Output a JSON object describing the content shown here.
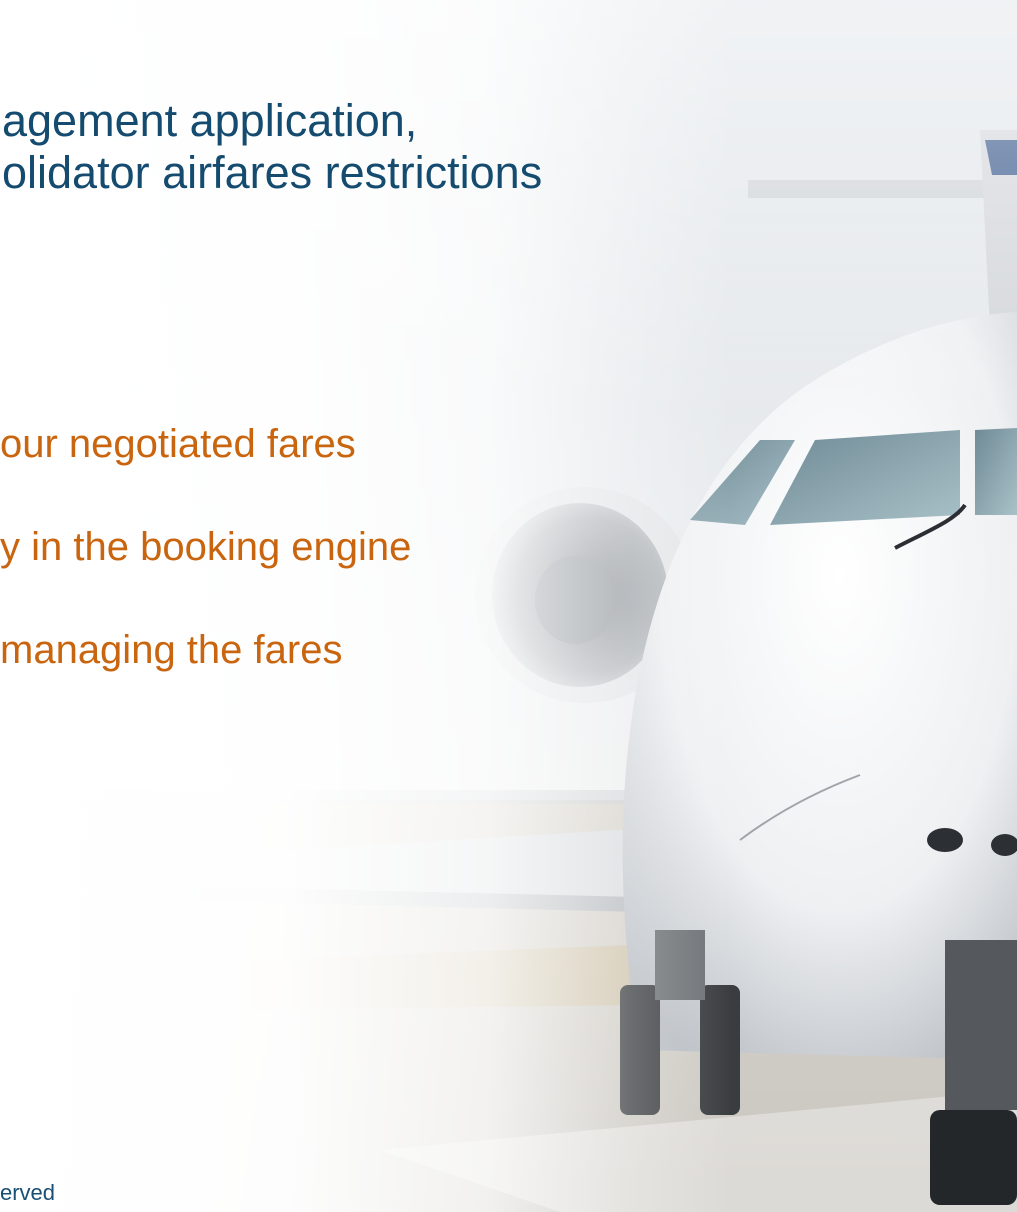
{
  "slide": {
    "title_lines": [
      "agement application,",
      "olidator airfares restrictions"
    ],
    "bullets": [
      "our negotiated fares",
      "y in the booking engine",
      "managing the fares"
    ],
    "footer": "erved"
  },
  "colors": {
    "title": "#144b6e",
    "bullets": "#c9650e",
    "footer": "#1a4f74"
  },
  "background_image": "airplane-jet-front-on-runway"
}
